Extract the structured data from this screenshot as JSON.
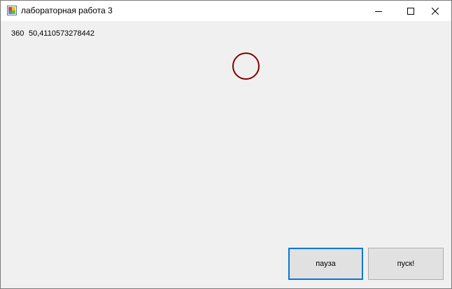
{
  "window": {
    "title": "лабораторная работа 3"
  },
  "titlebar": {
    "app_icon": "winforms-app-icon",
    "minimize_icon": "minimize-icon",
    "maximize_icon": "maximize-icon",
    "close_icon": "close-icon"
  },
  "labels": {
    "count": "360",
    "value": "50,4110573278442"
  },
  "canvas": {
    "shape": "circle-outline",
    "stroke_color": "#800000"
  },
  "buttons": {
    "pause_label": "пауза",
    "start_label": "пуск!"
  },
  "colors": {
    "focus_border": "#0078d7",
    "form_background": "#f0f0f0"
  }
}
